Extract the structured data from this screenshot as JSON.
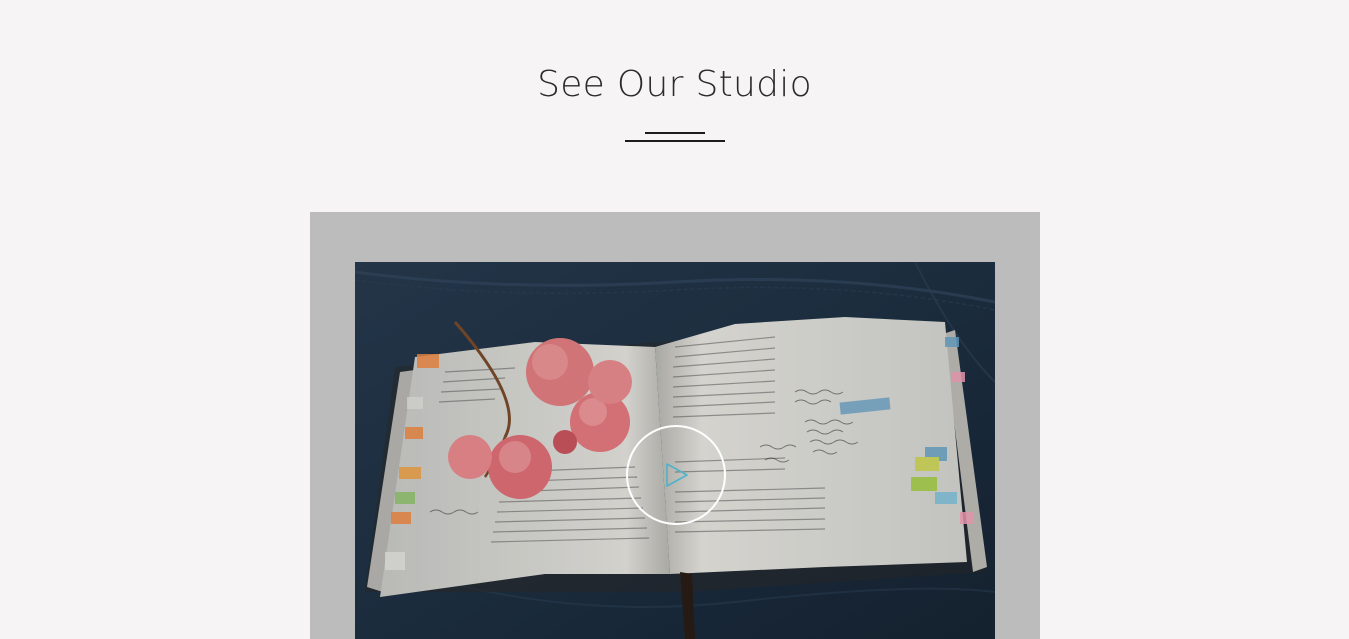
{
  "section": {
    "title": "See Our Studio"
  },
  "video": {
    "play_icon": "play-icon",
    "accent_color": "#4fb2c9"
  }
}
